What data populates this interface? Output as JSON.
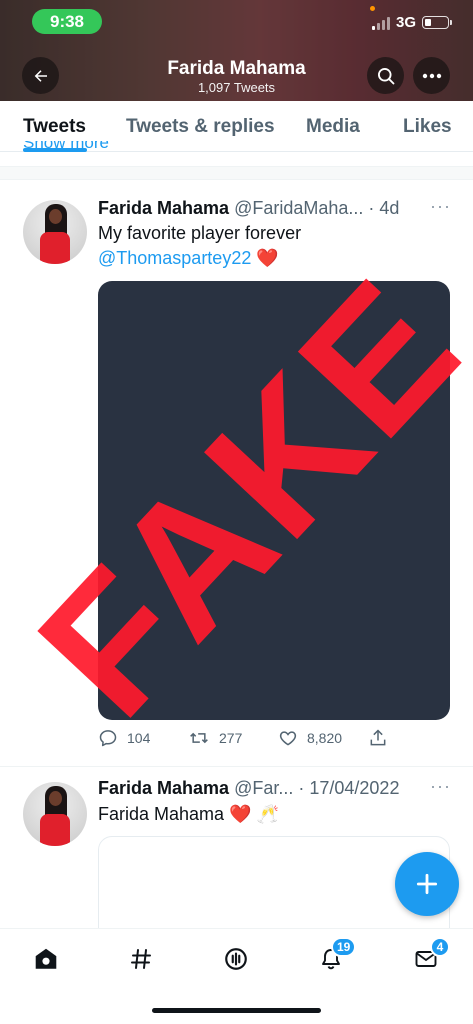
{
  "status_bar": {
    "time": "9:38",
    "network": "3G"
  },
  "header": {
    "name": "Farida Mahama",
    "tweet_count": "1,097 Tweets"
  },
  "tabs": [
    {
      "label": "Tweets",
      "active": true
    },
    {
      "label": "Tweets & replies",
      "active": false
    },
    {
      "label": "Media",
      "active": false
    },
    {
      "label": "Likes",
      "active": false
    }
  ],
  "show_more": "Show more",
  "tweets": [
    {
      "name": "Farida Mahama",
      "handle": "@FaridaMaha...",
      "time": "· 4d",
      "text": "My favorite player forever",
      "mention": "@Thomaspartey22",
      "emoji": "❤️",
      "replies": "104",
      "retweets": "277",
      "likes": "8,820"
    },
    {
      "name": "Farida Mahama",
      "handle": "@Far...",
      "time": "· 17/04/2022",
      "text": "Farida Mahama",
      "emoji": "❤️ 🥂"
    }
  ],
  "stamp": {
    "text": "FAKE",
    "color": "#ff1a2d"
  },
  "bottom_nav": {
    "notifications_badge": "19",
    "messages_badge": "4"
  },
  "colors": {
    "accent": "#1d9bf0",
    "media_bg": "#293241",
    "status_green": "#34c759"
  },
  "icons": [
    "back-arrow-icon",
    "search-icon",
    "more-icon",
    "reply-icon",
    "retweet-icon",
    "like-icon",
    "share-icon",
    "compose-plus-icon",
    "home-icon",
    "hashtag-icon",
    "spaces-icon",
    "bell-icon",
    "mail-icon"
  ]
}
